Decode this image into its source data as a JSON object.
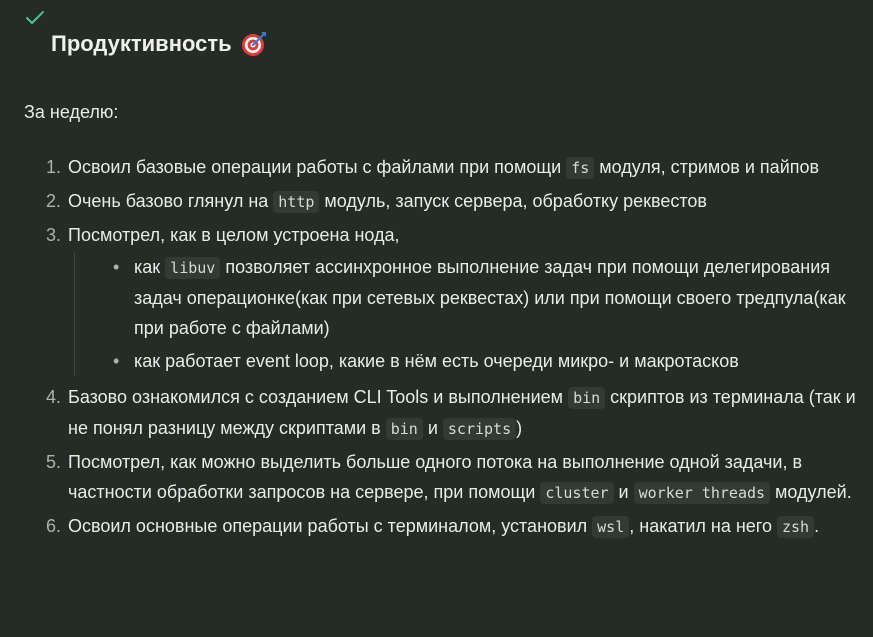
{
  "heading": "Продуктивность",
  "intro": "За неделю:",
  "items": {
    "i1": {
      "num": "1.",
      "a": "Освоил базовые операции работы с файлами при помощи ",
      "c1": "fs",
      "b": " модуля, стримов и пайпов"
    },
    "i2": {
      "num": "2.",
      "a": "Очень базово глянул на ",
      "c1": "http",
      "b": " модуль, запуск сервера, обработку реквестов"
    },
    "i3": {
      "num": "3.",
      "a": "Посмотрел, как в целом устроена нода,",
      "s1": {
        "bullet": "•",
        "a": "как ",
        "c1": "libuv",
        "b": " позволяет ассинхронное выполнение задач при помощи делегирования задач операционке(как при сетевых реквестах) или при помощи своего тредпула(как при работе с файлами)"
      },
      "s2": {
        "bullet": "•",
        "a": "как работает event loop, какие в нём есть очереди микро- и макротасков"
      }
    },
    "i4": {
      "num": "4.",
      "a": "Базово ознакомился с созданием CLI Tools и выполнением ",
      "c1": "bin",
      "b": " скриптов из терминала (так и не понял разницу между скриптами в ",
      "c2": "bin",
      "c": " и ",
      "c3": "scripts",
      "d": ")"
    },
    "i5": {
      "num": "5.",
      "a": "Посмотрел, как можно выделить больше одного потока на выполнение одной задачи, в частности обработки запросов на сервере, при помощи ",
      "c1": "cluster",
      "b": " и ",
      "c2": "worker threads",
      "c": " модулей."
    },
    "i6": {
      "num": "6.",
      "a": "Освоил основные операции работы с терминалом, установил ",
      "c1": "wsl",
      "b": ", накатил на него ",
      "c2": "zsh",
      "c": "."
    }
  },
  "icons": {
    "check": "check-icon",
    "target": "target-icon"
  }
}
